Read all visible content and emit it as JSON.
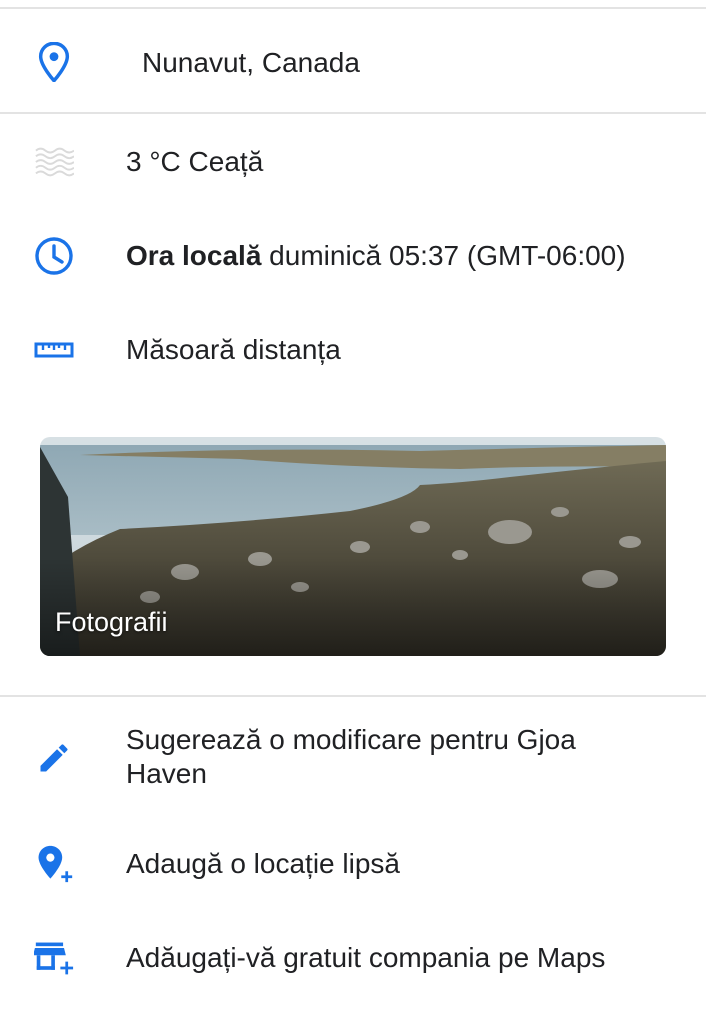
{
  "location": {
    "text": "Nunavut, Canada",
    "icon": "location-pin-icon"
  },
  "weather": {
    "text": "3 °C Ceață",
    "icon": "fog-icon"
  },
  "local_time": {
    "label": "Ora locală",
    "value": " duminică 05:37 (GMT-06:00)",
    "icon": "clock-icon"
  },
  "measure": {
    "text": "Măsoară distanța",
    "icon": "ruler-icon"
  },
  "photos": {
    "label": "Fotografii"
  },
  "actions": [
    {
      "text": "Sugerează o modificare pentru Gjoa Haven",
      "icon": "edit-pencil-icon"
    },
    {
      "text": "Adaugă o locație lipsă",
      "icon": "add-location-icon"
    },
    {
      "text": "Adăugați-vă gratuit compania pe Maps",
      "icon": "add-business-icon"
    }
  ],
  "colors": {
    "accent": "#1a73e8",
    "text": "#202124",
    "divider": "#e3e3e3"
  }
}
